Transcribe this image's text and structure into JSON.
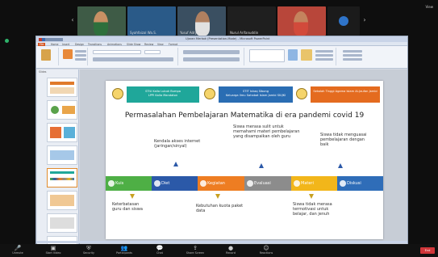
{
  "participants": [
    {
      "name": "",
      "skin": "#c89064",
      "hood": "#2d6f3c",
      "bg": "#3e5b46"
    },
    {
      "name": "Syahfaizal Wa.S.",
      "skin": "#a87a58",
      "hood": "#e7e9ef",
      "bg": "#2a5a88"
    },
    {
      "name": "Yusuf Adryansyah",
      "skin": "#b08060",
      "hood": "#e1e1e1",
      "bg": "#3a4f61"
    },
    {
      "name": "Nurul Arifanuddin",
      "skin": "",
      "hood": "",
      "bg": "#1f1f1f"
    },
    {
      "name": "",
      "skin": "#c4835e",
      "hood": "#d24a3b",
      "bg": "#b8463a"
    }
  ],
  "view_label": "View",
  "ppt": {
    "title": "Ujaran Merkok (Presentation-Mode) - Microsoft PowerPoint",
    "tabs": [
      "File",
      "Home",
      "Insert",
      "Design",
      "Transitions",
      "Animations",
      "Slide Show",
      "Review",
      "View",
      "Format"
    ],
    "thumbs_header": "Slides"
  },
  "slide": {
    "banners": [
      {
        "text": "STIU Kalla Lubuk Bumpa\nLPPI Kalla Mandaton",
        "color": "#1fa79a"
      },
      {
        "text": "STIT Ishaq Sibong\nKeluarga Ilmu Sahabat Islam Jambi SIUJKI",
        "color": "#2a6db3"
      },
      {
        "text": "Sekolah Tinggi Agama Islam Al-Jaufan Jambi",
        "color": "#e46b1f"
      }
    ],
    "title": "Permasalahan Pembelajaran Matematika di era pandemi covid 19",
    "top_labels": [
      "Kendala akses internet\n(jaringan/sinyal)",
      "Siswa merasa sulit untuk\nmemahami materi pembelajaran\nyang disampaikan oleh guru",
      "Siswa tidak menguasai\npembelajaran dengan\nbaik"
    ],
    "segments": [
      {
        "label": "Kuis",
        "color": "#4eaf45"
      },
      {
        "label": "Diet",
        "color": "#2b59a8"
      },
      {
        "label": "Kegiatan",
        "color": "#ee7d22"
      },
      {
        "label": "Evaluasi",
        "color": "#8c8c8c"
      },
      {
        "label": "Materi",
        "color": "#f2b61a"
      },
      {
        "label": "Diskusi",
        "color": "#2f6db8"
      }
    ],
    "bottom_labels": [
      "Keterbatasan\nguru dan siswa",
      "Kebutuhan kuota paket\ndata",
      "Siswa tidak merasa\ntermotivasi untuk\nbelajar, dan jenuh"
    ]
  },
  "toolbar": {
    "items": [
      {
        "icon": "microphone-icon",
        "glyph": "🎤",
        "label": "Unmute"
      },
      {
        "icon": "video-icon",
        "glyph": "▣",
        "label": "Start Video"
      },
      {
        "icon": "security-icon",
        "glyph": "⛨",
        "label": "Security"
      },
      {
        "icon": "participants-icon",
        "glyph": "👥",
        "label": "Participants"
      },
      {
        "icon": "chat-icon",
        "glyph": "💬",
        "label": "Chat"
      },
      {
        "icon": "share-icon",
        "glyph": "⇪",
        "label": "Share Screen"
      },
      {
        "icon": "record-icon",
        "glyph": "●",
        "label": "Record"
      },
      {
        "icon": "reactions-icon",
        "glyph": "☺",
        "label": "Reactions"
      }
    ],
    "end_label": "End"
  }
}
